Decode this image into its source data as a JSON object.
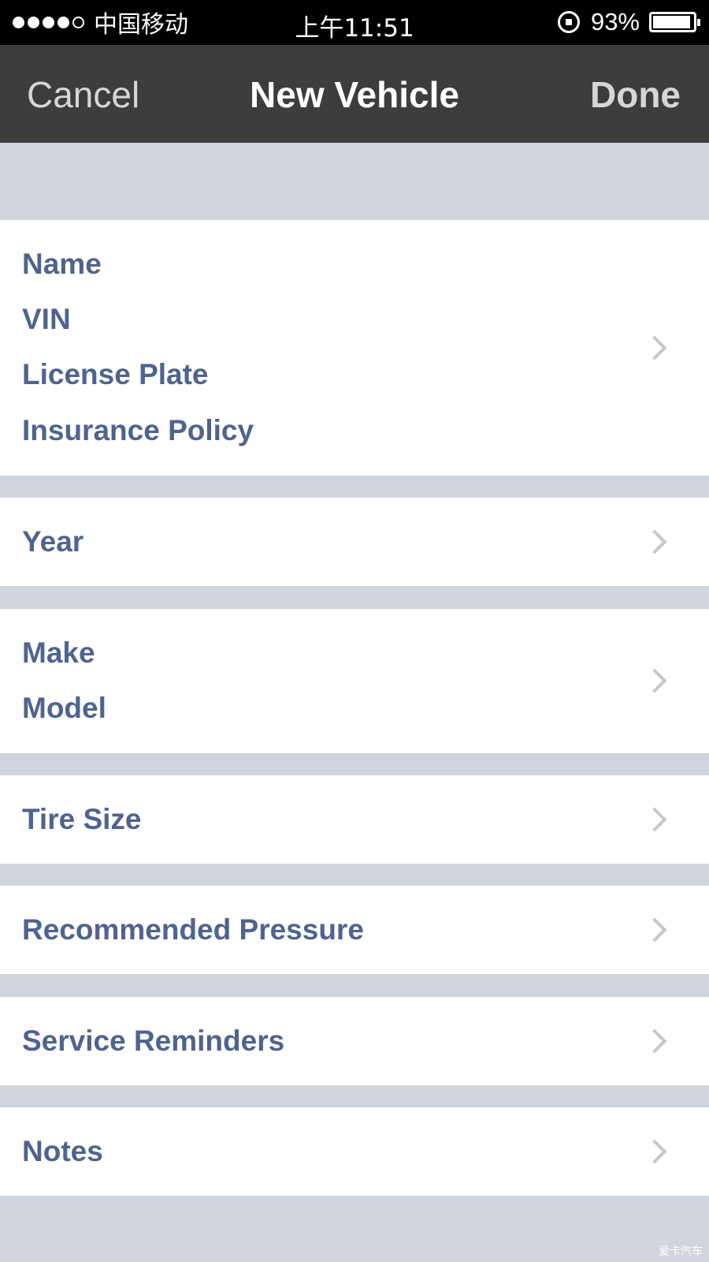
{
  "status_bar": {
    "carrier": "中国移动",
    "time": "上午11:51",
    "battery_percent": "93%",
    "battery_level": 0.93,
    "signal_bars_filled": 4,
    "signal_bars_total": 5
  },
  "nav": {
    "cancel_label": "Cancel",
    "title": "New Vehicle",
    "done_label": "Done"
  },
  "groups": {
    "identity": {
      "name": "Name",
      "vin": "VIN",
      "license_plate": "License Plate",
      "insurance_policy": "Insurance Policy"
    },
    "year": "Year",
    "make_model": {
      "make": "Make",
      "model": "Model"
    },
    "tire_size": "Tire Size",
    "recommended_pressure": "Recommended Pressure",
    "service_reminders": "Service Reminders",
    "notes": "Notes"
  },
  "watermark": "爱卡汽车",
  "colors": {
    "label_blue": "#4f638f",
    "nav_bg": "#3d3d3d",
    "group_bg": "#cfd4de",
    "chevron": "#c7c7cc"
  },
  "icons": {
    "chevron": "chevron-right-icon",
    "orientation_lock": "orientation-lock-icon",
    "battery": "battery-icon"
  }
}
